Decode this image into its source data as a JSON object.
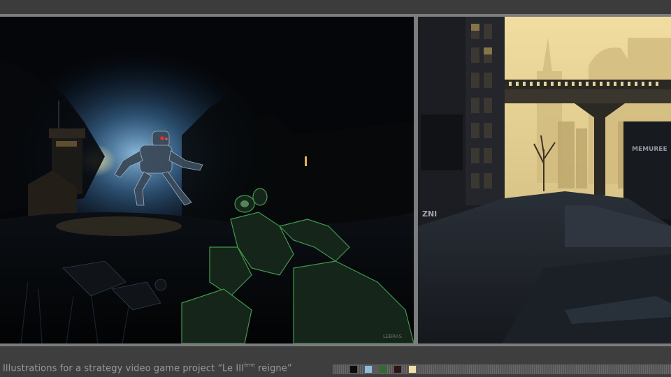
{
  "caption": {
    "prefix": "Illustrations for a strategy video game project “Le III",
    "superscript": "ème",
    "suffix": " reigne”"
  },
  "artwork": {
    "left_signature": "LEBRAS",
    "right_sign": "MEMUREE",
    "right_graffiti": "ZNI"
  },
  "swatches": [
    {
      "name": "black",
      "color": "#0c0c0c"
    },
    {
      "name": "sky-blue",
      "color": "#8fbde0"
    },
    {
      "name": "green",
      "color": "#2f6a2f"
    },
    {
      "name": "dark-red",
      "color": "#2e1414"
    },
    {
      "name": "cream",
      "color": "#f2dfa5"
    }
  ]
}
